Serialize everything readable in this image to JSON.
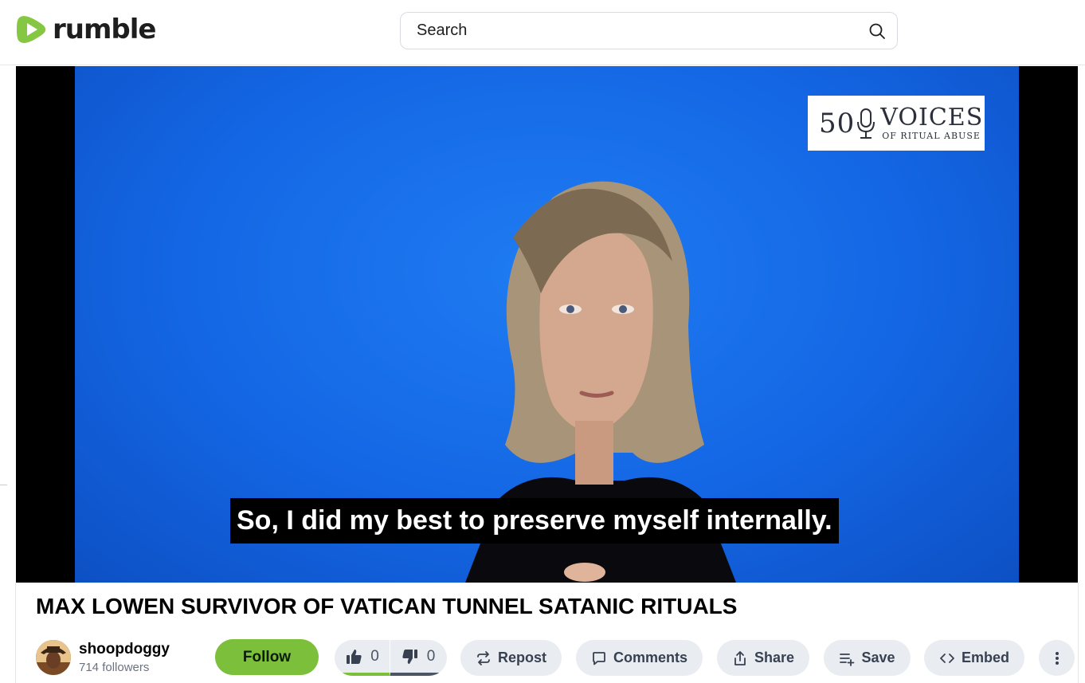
{
  "brand": {
    "name": "rumble",
    "accent": "#85c742"
  },
  "search": {
    "placeholder": "Search"
  },
  "video": {
    "overlay_badge": {
      "number": "50",
      "main": "VOICES",
      "sub": "OF RITUAL ABUSE"
    },
    "caption": "So, I did my best to preserve myself internally."
  },
  "title": "MAX LOWEN SURVIVOR OF VATICAN TUNNEL SATANIC RITUALS",
  "channel": {
    "name": "shoopdoggy",
    "followers": "714 followers"
  },
  "actions": {
    "follow": "Follow",
    "likes": "0",
    "dislikes": "0",
    "repost": "Repost",
    "comments": "Comments",
    "share": "Share",
    "save": "Save",
    "embed": "Embed"
  },
  "icons": [
    "play-logo-icon",
    "search-icon",
    "thumbs-up-icon",
    "thumbs-down-icon",
    "repost-icon",
    "comment-icon",
    "share-icon",
    "save-playlist-icon",
    "embed-code-icon",
    "more-vertical-icon",
    "microphone-icon"
  ]
}
